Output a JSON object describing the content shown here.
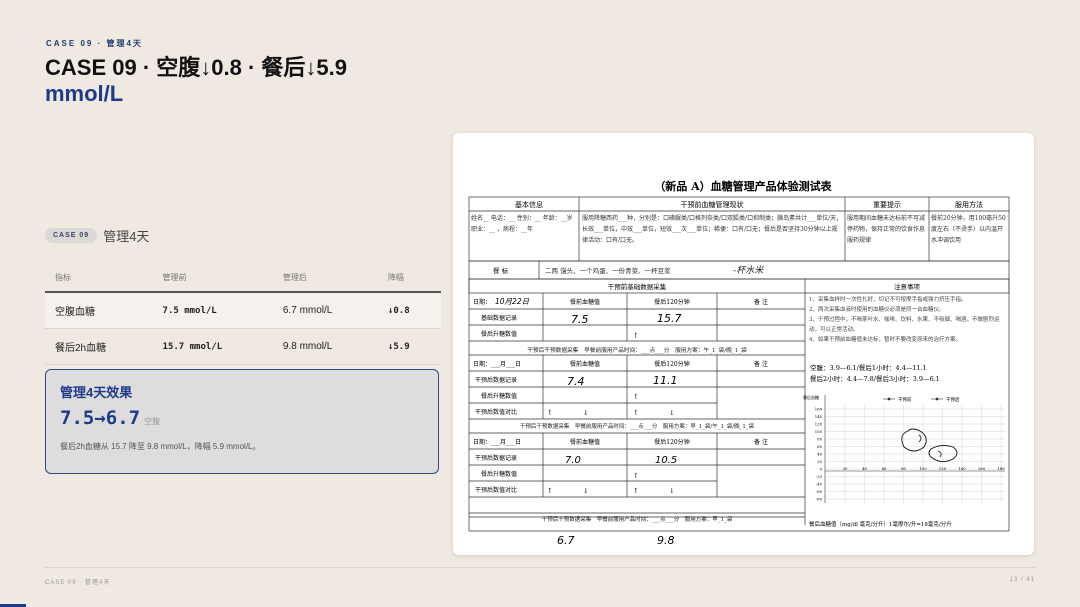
{
  "header": {
    "kicker": "CASE 09 · 管理4天",
    "title_main": "CASE 09 · 空腹↓0.8 · 餐后↓5.9",
    "title_unit": "mmol/L"
  },
  "tag": {
    "label": "CASE 09",
    "text": "管理4天"
  },
  "table": {
    "headers": [
      "指标",
      "管理前",
      "管理后",
      "降幅"
    ],
    "rows": [
      {
        "name": "空腹血糖",
        "before": "7.5 mmol/L",
        "after": "6.7 mmol/L",
        "delta": "↓0.8"
      },
      {
        "name": "餐后2h血糖",
        "before": "15.7 mmol/L",
        "after": "9.8 mmol/L",
        "delta": "↓5.9"
      }
    ]
  },
  "card": {
    "title": "管理4天效果",
    "value": "7.5→6.7",
    "sub": "空腹",
    "desc": "餐后2h血糖从 15.7 降至 9.8 mmol/L，降幅 5.9 mmol/L。"
  },
  "doc": {
    "title": "（新品 A）血糖管理产品体验测试表",
    "col_basic": "基本信息",
    "col_status": "干预前血糖管理现状",
    "col_tips": "重要提示",
    "col_method": "服用方法",
    "basic_text": "姓名__ 电话：__ 性别：__ 年龄：__岁 职业：__ ，病程：__年",
    "status_text": "服用降糖西药___种，分别是：口磺脲类/口格列奈类/口双胍类/口抑制类；胰岛素共计___单位/天，长效___单位，中效___单位，短效___次___单位；稀便：口有/口无；餐后是否坚持30分钟以上规律活动：口有/口无。",
    "tips_text": "服用期间血糖未达标前不可减停药物，保持正常的饮食作息服药规律",
    "method_text": "餐前20分钟，用100毫升50度左右（不烫手）以内温开水冲调饮用",
    "meal_label": "餐 标",
    "meal_value": "二两 馒头、一个鸡蛋、一份青菜、一杯豆浆",
    "meal_handwritten": "-杯水米",
    "section_base": "干预前基础数据采集",
    "section_notes": "注意事项",
    "date_label": "日期：",
    "date_hand": "10月22日",
    "col_fast": "餐前血糖值",
    "col_post": "餐后120分钟",
    "col_note": "备 注",
    "row_base_record": "基础数据记录",
    "row_rise": "餐后升糖数值",
    "row_after_record": "干预后数据记录",
    "row_after_rise": "餐后升糖数值",
    "row_compare": "干预后数值对比",
    "base_fast": "7.5",
    "base_post": "15.7",
    "section_day1": "干预后干预数据采集　早餐前服用产品时间：___点___分　服用方案：午_1_袋/晚_1_袋",
    "day1_fast": "7.4",
    "day1_post": "11.1",
    "section_day2": "干预后干预数据采集　早餐前服用产品时间：___点___分　服用方案：早_1_袋/午_1_袋/晚_1_袋",
    "day2_fast": "7.0",
    "day2_post": "10.5",
    "section_day3": "干预后干预数据采集　早餐前服用产品时间：___点___分　服用方案：早_1_袋",
    "day3_fast": "6.7",
    "day3_post": "9.8",
    "date_blank": "日期：___月___日",
    "notes": [
      "1、采集血样时一次性扎好，切记不可按摩手指或强力挤压手指。",
      "2、两次采集血液时使用的血糖仪必须是同一台血糖仪。",
      "3、干预过程中，不喝茶叶水、咖啡、饮料、水果、不吸烟、喝酒，不做剧烈运动，可以正常活动。",
      "4、如果干预前血糖值未达标，暂时不要改变原来的治疗方案。"
    ],
    "ref_fast": "空腹：3.9—6.1/餐后1小时：4.4—11.1",
    "ref_post": "餐后2小时：4.4—7.8/餐后3小时：3.9—6.1",
    "chart_legend1": "干预前",
    "chart_legend2": "干预后",
    "chart_ylabel": "餐后血糖",
    "chart_y_ticks": [
      "160",
      "140",
      "120",
      "100",
      "80",
      "60",
      "40",
      "20",
      "0",
      "-20",
      "-40",
      "-60",
      "-80"
    ],
    "chart_x_ticks": [
      "20",
      "40",
      "60",
      "80",
      "100",
      "120",
      "140",
      "160",
      "180"
    ],
    "footer_note": "餐后血糖值（mg/dl 毫克/分升）1毫摩尔/升=18毫克/分升",
    "arrow_up": "↑",
    "arrow_down": "↓"
  },
  "footer": {
    "left": "CASE 09 · 管理4天",
    "right": "13 / 41"
  },
  "progress": {
    "fraction": 0.024
  }
}
